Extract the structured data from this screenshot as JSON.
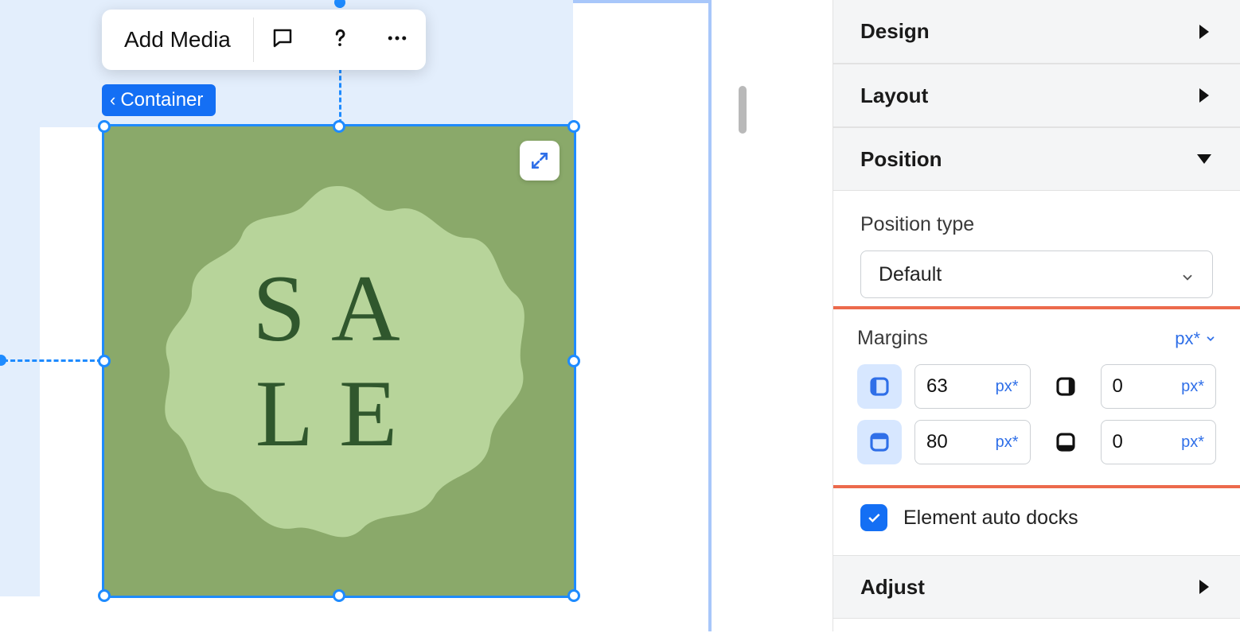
{
  "toolbar": {
    "add_media_label": "Add Media"
  },
  "breadcrumb": {
    "container_label": "Container"
  },
  "media": {
    "text_line1": "SA",
    "text_line2": "LE"
  },
  "panel": {
    "design_label": "Design",
    "layout_label": "Layout",
    "position_label": "Position",
    "adjust_label": "Adjust",
    "position_type_label": "Position type",
    "position_type_value": "Default",
    "margins_label": "Margins",
    "margins_unit": "px*",
    "margin_left": "63",
    "margin_right": "0",
    "margin_top": "80",
    "margin_bottom": "0",
    "field_unit": "px*",
    "auto_dock_label": "Element auto docks"
  }
}
